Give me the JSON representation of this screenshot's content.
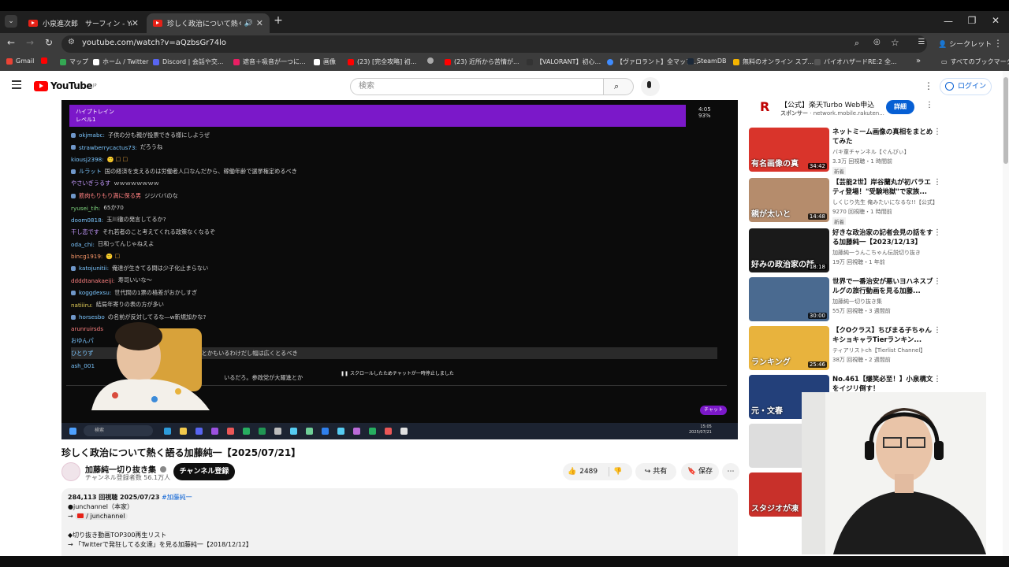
{
  "browser": {
    "tabs": [
      {
        "title": "小泉進次郎　サーフィン - YouTube"
      },
      {
        "title": "珍しく政治について熱く語る加藤"
      }
    ],
    "new_tab": "+",
    "url": "youtube.com/watch?v=aQzbsGr74lo",
    "incognito_label": "シークレット",
    "bookmarks": [
      {
        "label": "Gmail",
        "color": "#ea4335"
      },
      {
        "label": "マップ",
        "color": "#34a853"
      },
      {
        "label": "ホーム / Twitter",
        "color": "#ffffff"
      },
      {
        "label": "Discord | 会話や交...",
        "color": "#5865f2"
      },
      {
        "label": "遮音＋吸音が一つに...",
        "color": "#e91e63"
      },
      {
        "label": "画像",
        "color": "#ffffff"
      },
      {
        "label": "(23) [完全攻略] 初...",
        "color": "#ff0000"
      },
      {
        "label": "",
        "color": "#aaaaaa"
      },
      {
        "label": "(23) 近所から苦情が...",
        "color": "#ff0000"
      },
      {
        "label": "【VALORANT】初心...",
        "color": "#333333"
      },
      {
        "label": "【ヴァロラント】全マップ...",
        "color": "#3f8cff"
      },
      {
        "label": "SteamDB",
        "color": "#1b2838"
      },
      {
        "label": "無料のオンライン スプ...",
        "color": "#f4b400"
      },
      {
        "label": "バイオハザードRE:2 全...",
        "color": "#555555"
      }
    ],
    "bookmarks_overflow": "»",
    "all_bookmarks": "すべてのブックマーク"
  },
  "youtube": {
    "logo": "YouTube",
    "logo_region": "JP",
    "search_placeholder": "検索",
    "login_label": "ログイン",
    "video": {
      "banner_line1": "ハイプトレイン",
      "banner_line2": "レベル1",
      "banner_time": "4:05",
      "banner_percent": "93%",
      "chat": [
        {
          "user": "okjmabc:",
          "text": "子供の分も親が投票できる様にしようぜ"
        },
        {
          "user": "strawberrycactus73:",
          "text": "だろうね"
        },
        {
          "user": "kiousj2398:",
          "text": "🙂 ☐ ☐"
        },
        {
          "user": "ルラット",
          "text": "国の経済を支えるのは労働者人口なんだから、稼働年齢で選挙権定めるべき"
        },
        {
          "user": "やさいぎうるす",
          "text": "ｗｗｗｗｗｗｗｗ"
        },
        {
          "user": "筋肉もりもり満に保る男",
          "text": "ジジババのな"
        },
        {
          "user": "ryusei_tih:",
          "text": "65か70"
        },
        {
          "user": "doom0818:",
          "text": "玉川徹の発言してるか?"
        },
        {
          "user": "干し恋です",
          "text": "それ若者のこと考えてくれる政策なくなるぞ"
        },
        {
          "user": "oda_chi:",
          "text": "日和ってんじゃねえよ"
        },
        {
          "user": "bincg1919:",
          "text": "🙂 ☐"
        },
        {
          "user": "katojunitii:",
          "text": "俺達が生きてる間は少子化止まらない"
        },
        {
          "user": "ddddtanakaeiji:",
          "text": "寿司いいな〜"
        },
        {
          "user": "koggdexsu:",
          "text": "世代間の1票の格差がおかしすぎ"
        },
        {
          "user": "natiiiru:",
          "text": "結局年寄りの表の方が多い"
        },
        {
          "user": "horsesbo",
          "text": "の名前が反対してるな―w新規加かな?"
        },
        {
          "user": "arunruirsds",
          "text": ""
        },
        {
          "user": "おゆんパ",
          "text": ""
        },
        {
          "user": "ひとりず",
          "text": "結局出さないとかもいるわけだし幅は広くとるべき"
        },
        {
          "user": "ash_001",
          "text": ""
        },
        {
          "user": "",
          "text": "いるだろ。参政党が大躍進とか"
        }
      ],
      "paused_notice": "スクロールしたためチャットが一時停止しました",
      "chat_button": "チャット",
      "taskbar_search": "検索",
      "taskbar_time": "15:05",
      "taskbar_date": "2025/07/21"
    },
    "title": "珍しく政治について熱く語る加藤純一【2025/07/21】",
    "channel": {
      "name": "加藤純一切り抜き集",
      "subscribers": "チャンネル登録者数 56.1万人",
      "subscribe_label": "チャンネル登録"
    },
    "actions": {
      "likes": "2489",
      "share": "共有",
      "save": "保存",
      "more": "⋯"
    },
    "description": {
      "views_date": "284,113 回視聴  2025/07/23",
      "hashtag": "#加藤純一",
      "line1": "●junchannel（本家）",
      "line2_arrow": "→",
      "line2_link": "/ junchannel",
      "line3": "◆切り抜き動画TOP300再生リスト",
      "line4": "→ 「Twitterで発狂してる女達」を見る加藤純一【2018/12/12】"
    },
    "ad": {
      "title": "【公式】楽天Turbo Web申込",
      "sponsor": "スポンサー",
      "domain": "network.mobile.rakuten...",
      "button": "詳細"
    },
    "recommendations": [
      {
        "title": "ネットミーム画像の真相をまとめてみた",
        "channel": "バキ童チャンネル【ぐんぴぃ】",
        "meta": "3.3万 回視聴・1 時間前",
        "badge": "新着",
        "duration": "34:42",
        "thumb_text": "有名画像の真",
        "thumb_color": "#d9342b"
      },
      {
        "title": "【芸能2世】岸谷蘭丸が初バラエティ登場！\"受験地獄\"で家族...",
        "channel": "しくじり先生 俺みたいになるな!!【公式】",
        "meta": "9270 回視聴・1 時間前",
        "badge": "新着",
        "duration": "14:48",
        "thumb_text": "親が太いと",
        "thumb_color": "#b58c6c"
      },
      {
        "title": "好きな政治家の記者会見の話をする加藤純一【2023/12/13】",
        "channel": "加藤純一うんこちゃん伝説切り抜き",
        "meta": "19万 回視聴・1 年前",
        "badge": "",
        "duration": "18:18",
        "thumb_text": "好みの政治家の話",
        "thumb_color": "#1a1a1a"
      },
      {
        "title": "世界で一番治安が悪いヨハネスブルグの旅行動画を見る加藤...",
        "channel": "加藤純一切り抜き集",
        "meta": "55万 回視聴・3 週間前",
        "badge": "",
        "duration": "30:00",
        "thumb_text": "",
        "thumb_color": "#4a6a90"
      },
      {
        "title": "【クOクラス】ちびまる子ちゃんキショキャラTierランキン...",
        "channel": "ティアリストch【Tierlist Channel】",
        "meta": "38万 回視聴・2 週間前",
        "badge": "",
        "duration": "25:46",
        "thumb_text": "ランキング",
        "thumb_color": "#e8b33d"
      },
      {
        "title": "No.461【爆笑必至！】小泉構文をイジリ倒す！",
        "channel": "",
        "meta": "",
        "badge": "",
        "duration": "",
        "thumb_text": "元・文春",
        "thumb_color": "#23407a"
      },
      {
        "title": "",
        "channel": "",
        "meta": "",
        "badge": "",
        "duration": "",
        "thumb_text": "",
        "thumb_color": "#dddddd"
      },
      {
        "title": "",
        "channel": "",
        "meta": "",
        "badge": "",
        "duration": "",
        "thumb_text": "スタジオが凍",
        "thumb_color": "#c8302a"
      }
    ]
  }
}
